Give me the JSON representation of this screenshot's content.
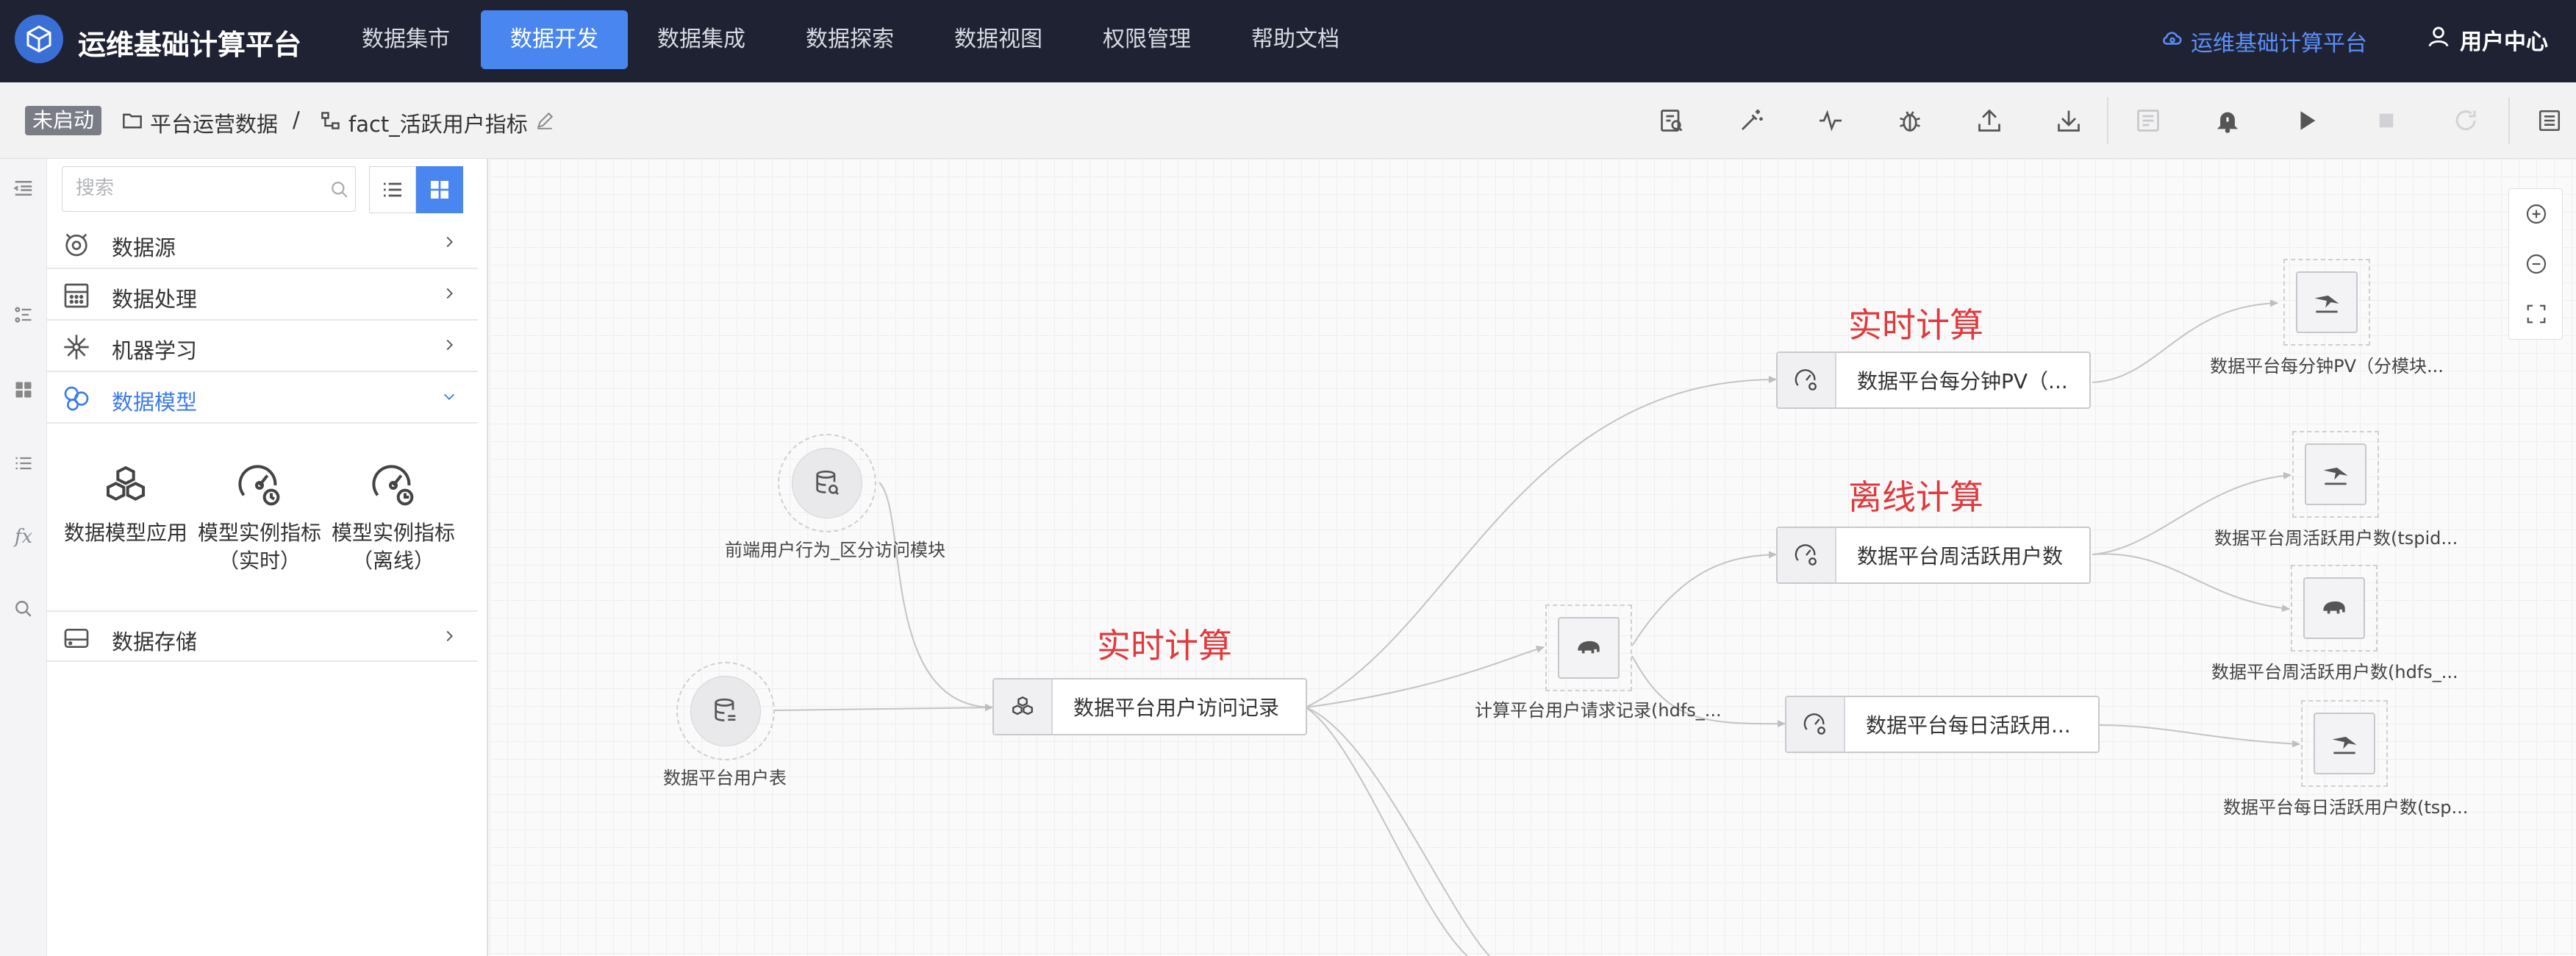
{
  "app": {
    "title": "运维基础计算平台",
    "logo_icon": "cube-icon"
  },
  "nav": {
    "items": [
      {
        "label": "数据集市",
        "active": false
      },
      {
        "label": "数据开发",
        "active": true
      },
      {
        "label": "数据集成",
        "active": false
      },
      {
        "label": "数据探索",
        "active": false
      },
      {
        "label": "数据视图",
        "active": false
      },
      {
        "label": "权限管理",
        "active": false
      },
      {
        "label": "帮助文档",
        "active": false
      }
    ],
    "platform_link": "运维基础计算平台",
    "user_center": "用户中心"
  },
  "toolbar": {
    "status": "未启动",
    "breadcrumb": [
      "平台运营数据",
      "/",
      "fact_活跃用户指标"
    ],
    "buttons": [
      "validate-icon",
      "magic-wand-icon",
      "pulse-icon",
      "debug-icon",
      "upload-icon",
      "download-icon",
      "report-icon",
      "alarm-bell-icon",
      "play-icon",
      "stop-icon",
      "refresh-icon",
      "list-panel-icon"
    ]
  },
  "sidebar": {
    "search_placeholder": "搜索",
    "categories": [
      {
        "label": "数据源",
        "icon": "datasource-icon",
        "expanded": false
      },
      {
        "label": "数据处理",
        "icon": "calculator-icon",
        "expanded": false
      },
      {
        "label": "机器学习",
        "icon": "network-icon",
        "expanded": false
      },
      {
        "label": "数据模型",
        "icon": "model-icon",
        "expanded": true
      },
      {
        "label": "数据存储",
        "icon": "storage-icon",
        "expanded": false
      }
    ],
    "model_tools": [
      {
        "label": "数据模型应用",
        "icon": "cubes-icon"
      },
      {
        "label": "模型实例指标（实时）",
        "icon": "gauge-realtime-icon"
      },
      {
        "label": "模型实例指标（离线）",
        "icon": "gauge-offline-icon"
      }
    ]
  },
  "canvas": {
    "phase_labels": [
      "实时计算",
      "实时计算",
      "离线计算"
    ],
    "source_nodes": [
      {
        "label": "前端用户行为_区分访问模块"
      },
      {
        "label": "数据平台用户表"
      }
    ],
    "process_nodes": [
      {
        "label": "数据平台用户访问记录"
      },
      {
        "label": "数据平台每分钟PV（..."
      },
      {
        "label": "数据平台周活跃用户数"
      },
      {
        "label": "数据平台每日活跃用..."
      }
    ],
    "middle_node": {
      "label": "计算平台用户请求记录(hdfs_..."
    },
    "sink_nodes": [
      {
        "label": "数据平台每分钟PV（分模块..."
      },
      {
        "label": "数据平台周活跃用户数(tspid..."
      },
      {
        "label": "数据平台周活跃用户数(hdfs_..."
      },
      {
        "label": "数据平台每日活跃用户数(tsp..."
      }
    ]
  },
  "colors": {
    "nav_bg": "#1f2232",
    "accent": "#4a86f0",
    "phase": "#e0393e"
  }
}
